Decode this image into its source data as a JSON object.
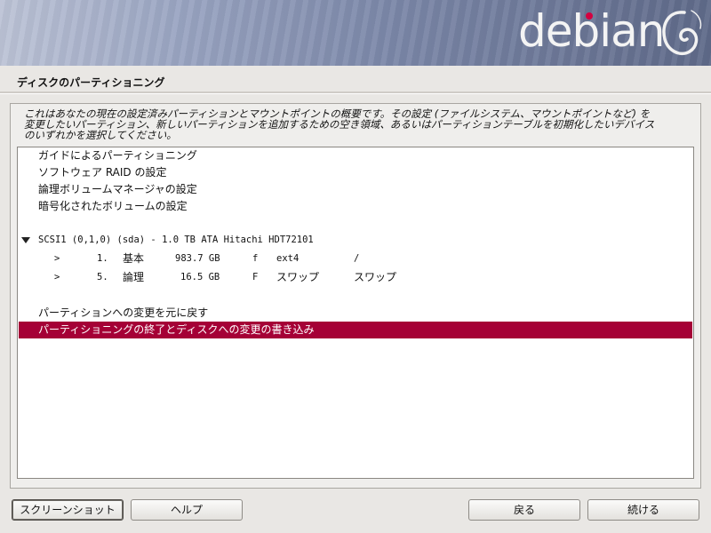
{
  "header": {
    "logo_text": "debian",
    "logo_dot_color": "#d40040",
    "logo_swirl_icon": "debian-swirl-icon"
  },
  "page": {
    "title": "ディスクのパーティショニング",
    "description_line1": "これはあなたの現在の設定済みパーティションとマウントポイントの概要です。その設定 (ファイルシステム、マウントポイントなど) を",
    "description_line2": "変更したいパーティション、新しいパーティションを追加するための空き領域、あるいはパーティションテーブルを初期化したいデバイス",
    "description_line3": "のいずれかを選択してください。"
  },
  "list": {
    "items": [
      {
        "label": "ガイドによるパーティショニング"
      },
      {
        "label": "ソフトウェア RAID の設定"
      },
      {
        "label": "論理ボリュームマネージャの設定"
      },
      {
        "label": "暗号化されたボリュームの設定"
      }
    ],
    "disk": {
      "label": "SCSI1 (0,1,0) (sda) - 1.0 TB ATA Hitachi HDT72101",
      "expander_icon": "triangle-down-icon"
    },
    "partitions": [
      {
        "marker": ">",
        "number": "1.",
        "type": "基本",
        "size": "983.7 GB",
        "flag": "f",
        "fs": "ext4",
        "mount": "/"
      },
      {
        "marker": ">",
        "number": "5.",
        "type": "論理",
        "size": "16.5 GB",
        "flag": "F",
        "fs": "スワップ",
        "mount": "スワップ"
      }
    ],
    "undo": "パーティションへの変更を元に戻す",
    "finish": "パーティショニングの終了とディスクへの変更の書き込み",
    "selected_color": "#a50036"
  },
  "buttons": {
    "screenshot": "スクリーンショット",
    "help": "ヘルプ",
    "back": "戻る",
    "continue": "続ける"
  }
}
